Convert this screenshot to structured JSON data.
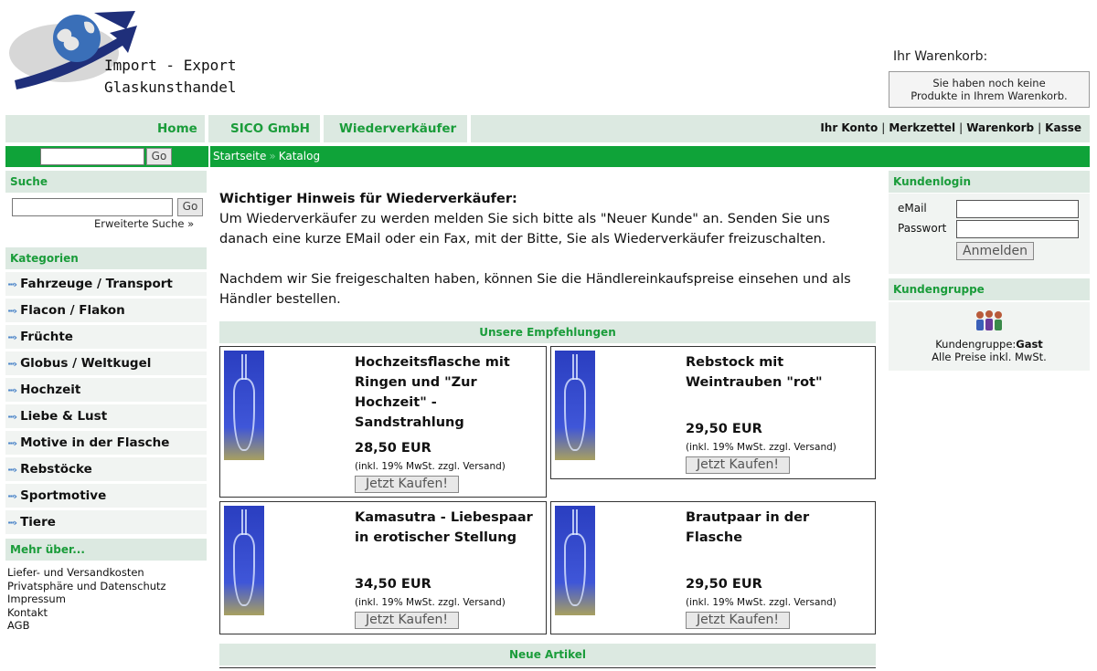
{
  "logo": {
    "line1": "Import - Export",
    "line2": "Glaskunsthandel"
  },
  "cart": {
    "title": "Ihr Warenkorb:",
    "empty_line1": "Sie haben noch keine",
    "empty_line2": "Produkte in Ihrem Warenkorb."
  },
  "nav": {
    "items": [
      "Home",
      "SICO GmbH",
      "Wiederverkäufer"
    ],
    "right": [
      "Ihr Konto",
      "Merkzettel",
      "Warenkorb",
      "Kasse"
    ]
  },
  "top_search": {
    "button": "Go"
  },
  "breadcrumb": {
    "home": "Startseite",
    "arrow": "»",
    "current": "Katalog"
  },
  "search_box": {
    "title": "Suche",
    "button": "Go",
    "advanced": "Erweiterte Suche »"
  },
  "categories": {
    "title": "Kategorien",
    "items": [
      "Fahrzeuge / Transport",
      "Flacon / Flakon",
      "Früchte",
      "Globus / Weltkugel",
      "Hochzeit",
      "Liebe & Lust",
      "Motive in der Flasche",
      "Rebstöcke",
      "Sportmotive",
      "Tiere"
    ]
  },
  "more": {
    "title": "Mehr über...",
    "items": [
      "Liefer- und Versandkosten",
      "Privatsphäre und Datenschutz",
      "Impressum",
      "Kontakt",
      "AGB"
    ]
  },
  "notice": {
    "heading": "Wichtiger Hinweis für Wiederverkäufer:",
    "p1": "Um Wiederverkäufer zu werden melden Sie sich bitte als \"Neuer Kunde\" an. Senden Sie uns danach eine kurze EMail oder ein Fax, mit der Bitte, Sie als Wiederverkäufer freizuschalten.",
    "p2": "Nachdem wir Sie freigeschalten haben, können Sie die Händlereinkaufspreise einsehen und als Händler bestellen."
  },
  "recommendations": {
    "title": "Unsere Empfehlungen",
    "products": [
      {
        "name": "Hochzeitsflasche mit Ringen und \"Zur Hochzeit\" - Sandstrahlung",
        "price": "28,50 EUR",
        "tax": "(inkl. 19% MwSt. zzgl. Versand)",
        "button": "Jetzt Kaufen!"
      },
      {
        "name": "Rebstock mit Weintrauben \"rot\"",
        "price": "29,50 EUR",
        "tax": "(inkl. 19% MwSt. zzgl. Versand)",
        "button": "Jetzt Kaufen!"
      },
      {
        "name": "Kamasutra - Liebespaar in erotischer Stellung",
        "price": "34,50 EUR",
        "tax": "(inkl. 19% MwSt. zzgl. Versand)",
        "button": "Jetzt Kaufen!"
      },
      {
        "name": "Brautpaar in der Flasche",
        "price": "29,50 EUR",
        "tax": "(inkl. 19% MwSt. zzgl. Versand)",
        "button": "Jetzt Kaufen!"
      }
    ]
  },
  "new_articles": {
    "title": "Neue Artikel"
  },
  "login": {
    "title": "Kundenlogin",
    "email_label": "eMail",
    "password_label": "Passwort",
    "button": "Anmelden"
  },
  "customer_group": {
    "title": "Kundengruppe",
    "label": "Kundengruppe:",
    "value": "Gast",
    "note": "Alle Preise inkl. MwSt."
  },
  "colors": {
    "green": "#0fa339",
    "link_green": "#1a9c3a",
    "header_bg": "#dce9e1"
  }
}
